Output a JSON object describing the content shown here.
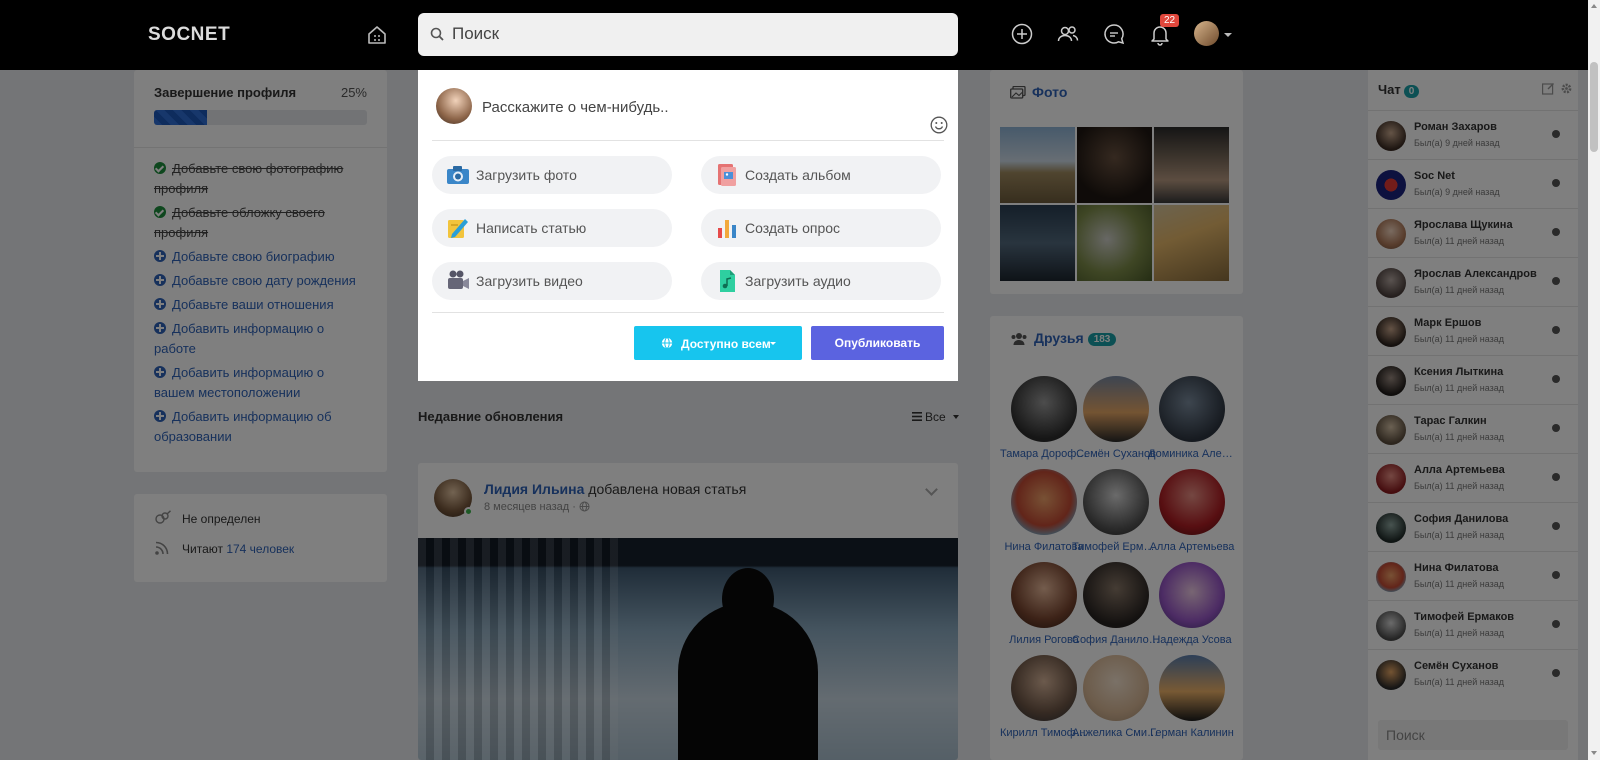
{
  "header": {
    "logo": "SOCNET",
    "search_placeholder": "Поиск",
    "notifications_count": "22"
  },
  "profile_completion": {
    "title": "Завершение профиля",
    "percent_label": "25%",
    "progress": 0.25,
    "tasks": [
      {
        "label": "Добавьте свою фотографию профиля",
        "done": true
      },
      {
        "label": "Добавьте обложку своего профиля",
        "done": true
      },
      {
        "label": "Добавьте свою биографию",
        "done": false
      },
      {
        "label": "Добавьте свою дату рождения",
        "done": false
      },
      {
        "label": "Добавьте ваши отношения",
        "done": false
      },
      {
        "label": "Добавить информацию о работе",
        "done": false
      },
      {
        "label": "Добавить информацию о вашем местоположении",
        "done": false
      },
      {
        "label": "Добавить информацию об образовании",
        "done": false
      }
    ]
  },
  "profile_info": {
    "gender": "Не определен",
    "followers_prefix": "Читают",
    "followers_link": "174 человек"
  },
  "composer": {
    "placeholder": "Расскажите о чем-нибудь..",
    "actions": [
      {
        "label": "Загрузить фото",
        "icon": "camera-icon"
      },
      {
        "label": "Создать альбом",
        "icon": "album-icon"
      },
      {
        "label": "Написать статью",
        "icon": "article-icon"
      },
      {
        "label": "Создать опрос",
        "icon": "poll-icon"
      },
      {
        "label": "Загрузить видео",
        "icon": "video-camera-icon"
      },
      {
        "label": "Загрузить аудио",
        "icon": "audio-file-icon"
      }
    ],
    "visibility_label": "Доступно всем",
    "publish_label": "Опубликовать"
  },
  "feed": {
    "section_title": "Недавние обновления",
    "filter_label": "Все",
    "post": {
      "author": "Лидия Ильина",
      "action": "добавлена новая статья",
      "time": "8 месяцев назад"
    }
  },
  "photos": {
    "title": "Фото"
  },
  "friends": {
    "title": "Друзья",
    "count": "183",
    "items": [
      {
        "name": "Тамара Дорофеева"
      },
      {
        "name": "Семён Суханов"
      },
      {
        "name": "Доминика Александрова"
      },
      {
        "name": "Нина Филатова"
      },
      {
        "name": "Тимофей Ермаков"
      },
      {
        "name": "Алла Артемьева"
      },
      {
        "name": "Лилия Рогова"
      },
      {
        "name": "София Данилова"
      },
      {
        "name": "Надежда Усова"
      },
      {
        "name": "Кирилл Тимофеев"
      },
      {
        "name": "Анжелика Смирнова"
      },
      {
        "name": "Герман Калинин"
      }
    ]
  },
  "chat": {
    "title": "Чат",
    "count": "0",
    "search_placeholder": "Поиск",
    "items": [
      {
        "name": "Роман Захаров",
        "status": "Был(а) 9 дней назад"
      },
      {
        "name": "Soc Net",
        "status": "Был(а) 9 дней назад"
      },
      {
        "name": "Ярослава Щукина",
        "status": "Был(а) 11 дней назад"
      },
      {
        "name": "Ярослав Александров",
        "status": "Был(а) 11 дней назад"
      },
      {
        "name": "Марк Ершов",
        "status": "Был(а) 11 дней назад"
      },
      {
        "name": "Ксения Лыткина",
        "status": "Был(а) 11 дней назад"
      },
      {
        "name": "Тарас Галкин",
        "status": "Был(а) 11 дней назад"
      },
      {
        "name": "Алла Артемьева",
        "status": "Был(а) 11 дней назад"
      },
      {
        "name": "София Данилова",
        "status": "Был(а) 11 дней назад"
      },
      {
        "name": "Нина Филатова",
        "status": "Был(а) 11 дней назад"
      },
      {
        "name": "Тимофей Ермаков",
        "status": "Был(а) 11 дней назад"
      },
      {
        "name": "Семён Суханов",
        "status": "Был(а) 11 дней назад"
      }
    ]
  }
}
